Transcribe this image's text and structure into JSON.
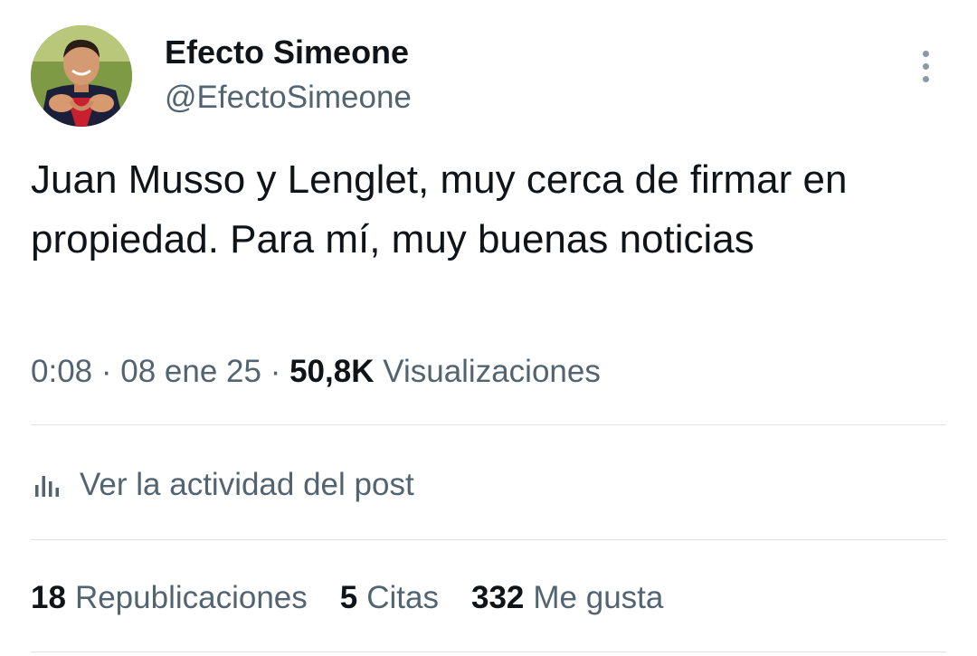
{
  "author": {
    "display_name": "Efecto Simeone",
    "handle": "@EfectoSimeone",
    "avatar_description": "profile-photo"
  },
  "post": {
    "text": "Juan Musso y Lenglet, muy cerca de firmar en propiedad. Para mí, muy buenas noticias",
    "time": "0:08",
    "separator": "·",
    "date": "08 ene 25",
    "views_count": "50,8K",
    "views_label": "Visualizaciones"
  },
  "activity": {
    "icon": "bar-chart-icon",
    "label": "Ver la actividad del post"
  },
  "stats": {
    "reposts_count": "18",
    "reposts_label": "Republicaciones",
    "quotes_count": "5",
    "quotes_label": "Citas",
    "likes_count": "332",
    "likes_label": "Me gusta"
  },
  "colors": {
    "primary_text": "#0f1419",
    "secondary_text": "#536471",
    "divider": "#dfe3e7"
  }
}
